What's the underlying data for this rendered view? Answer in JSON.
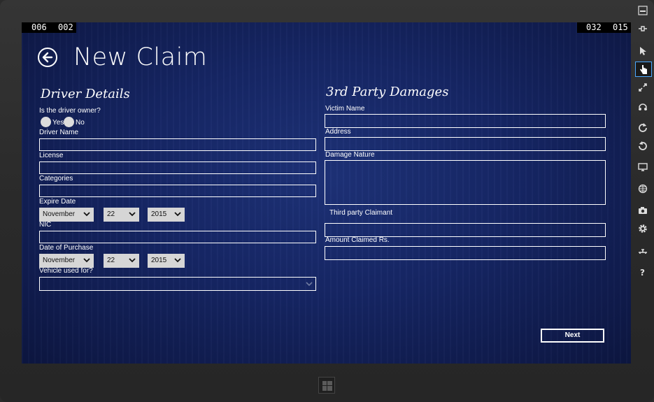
{
  "fps_counters": {
    "left_a": "006",
    "left_b": "002",
    "right_a": "032",
    "right_b": "015"
  },
  "page": {
    "title": "New Claim"
  },
  "driver": {
    "section_title": "Driver Details",
    "owner_question": "Is the driver owner?",
    "owner_yes": "Yes",
    "owner_no": "No",
    "name_label": "Driver Name",
    "license_label": "License",
    "categories_label": "Categories",
    "expire_label": "Expire Date",
    "expire_month": "November",
    "expire_day": "22",
    "expire_year": "2015",
    "nic_label": "NIC",
    "purchase_label": "Date of Purchase",
    "purchase_month": "November",
    "purchase_day": "22",
    "purchase_year": "2015",
    "vehicle_use_label": "Vehicle used for?"
  },
  "third_party": {
    "section_title": "3rd Party Damages",
    "victim_label": "Victim Name",
    "address_label": "Address",
    "damage_label": "Damage Nature",
    "claimant_label": "Third party Claimant",
    "amount_label": "Amount Claimed Rs."
  },
  "actions": {
    "next_label": "Next"
  },
  "toolbar": {
    "tools": [
      "minimize-icon",
      "pin-icon",
      "mouse-pointer-icon",
      "touch-hand-icon",
      "pinch-zoom-icon",
      "rotate-gesture-icon",
      "rotate-clockwise-icon",
      "rotate-counterclockwise-icon",
      "resolution-icon",
      "location-icon",
      "camera-icon",
      "settings-icon",
      "network-icon",
      "help-icon"
    ],
    "active_tool": "touch-hand-icon",
    "help_glyph": "?"
  },
  "colors": {
    "background_accent": "#162665",
    "field_border": "#ffffff",
    "combo_fill": "#d6d6d6"
  }
}
